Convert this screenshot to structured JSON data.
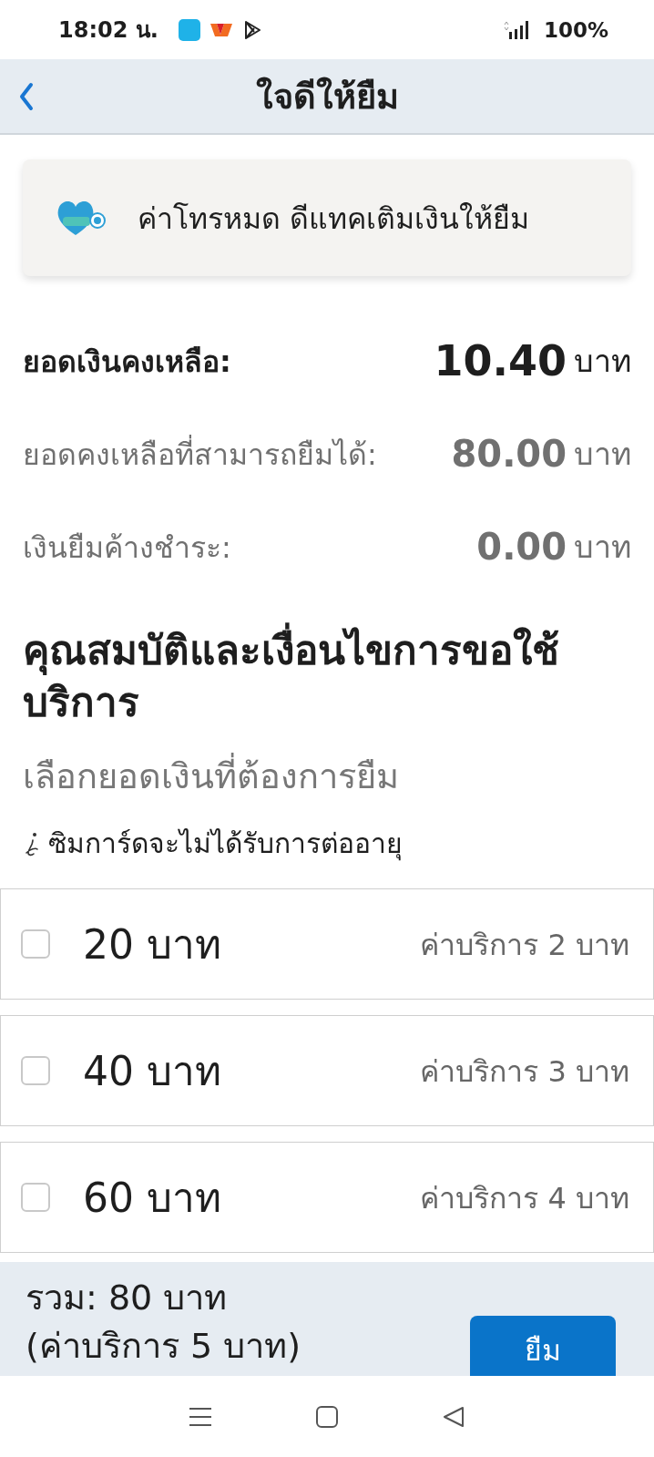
{
  "status_bar": {
    "time": "18:02 น.",
    "battery": "100%"
  },
  "header": {
    "title": "ใจดีให้ยืม"
  },
  "banner": {
    "text": "ค่าโทรหมด ดีแทคเติมเงินให้ยืม"
  },
  "balances": [
    {
      "kind": "primary",
      "label": "ยอดเงินคงเหลือ:",
      "amount": "10.40",
      "unit": "บาท"
    },
    {
      "kind": "secondary",
      "label": "ยอดคงเหลือที่สามารถยืมได้:",
      "amount": "80.00",
      "unit": "บาท"
    },
    {
      "kind": "secondary",
      "label": "เงินยืมค้างชำระ:",
      "amount": "0.00",
      "unit": "บาท"
    }
  ],
  "section": {
    "heading": "คุณสมบัติและเงื่อนไขการขอใช้บริการ",
    "subtitle": "เลือกยอดเงินที่ต้องการยืม",
    "note": "ซิมการ์ดจะไม่ได้รับการต่ออายุ"
  },
  "options": [
    {
      "amount": "20 บาท",
      "fee": "ค่าบริการ 2 บาท",
      "checked": false
    },
    {
      "amount": "40 บาท",
      "fee": "ค่าบริการ 3 บาท",
      "checked": false
    },
    {
      "amount": "60 บาท",
      "fee": "ค่าบริการ 4 บาท",
      "checked": false
    }
  ],
  "footer": {
    "total": "รวม: 80 บาท",
    "fee": "(ค่าบริการ 5 บาท)",
    "button": "ยืม"
  }
}
